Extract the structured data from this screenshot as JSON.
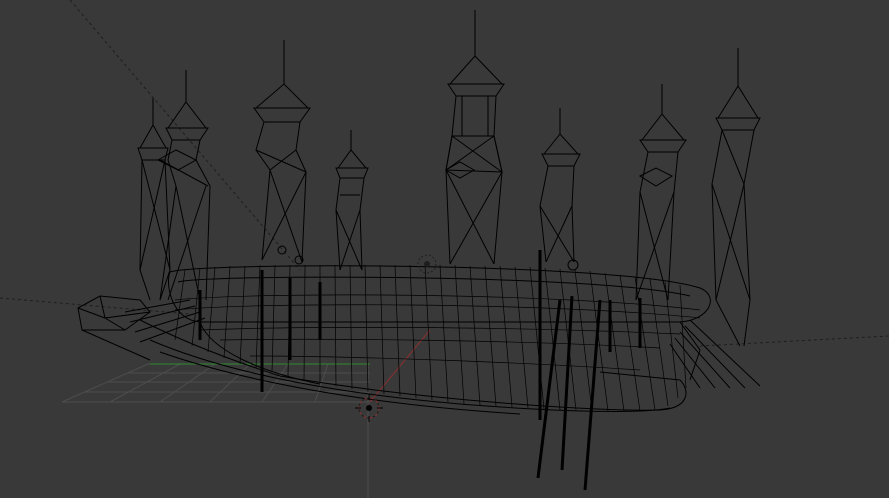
{
  "viewport": {
    "mode": "wireframe",
    "background_color": "#393939",
    "wire_color": "#000000",
    "grid_color": "#4d4d4d",
    "axis_x_color": "#8a2f2f",
    "axis_y_color": "#2f8a2f",
    "object_name_icons": [
      "3d-cursor-icon",
      "object-origin-icon"
    ]
  }
}
